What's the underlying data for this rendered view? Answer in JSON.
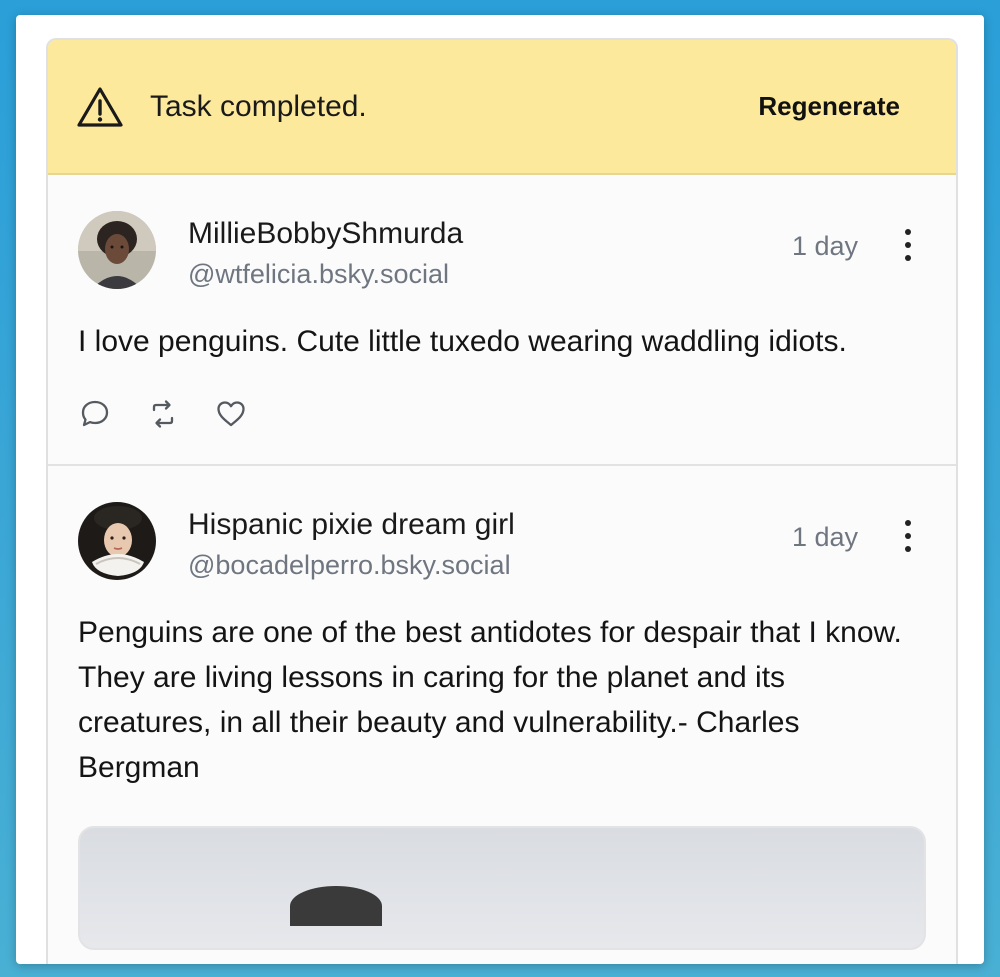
{
  "banner": {
    "icon": "warning-triangle-icon",
    "message": "Task completed.",
    "action_label": "Regenerate",
    "background": "#fde99c"
  },
  "posts": [
    {
      "display_name": "MillieBobbyShmurda",
      "handle": "@wtfelicia.bsky.social",
      "time": "1 day",
      "text": "I love penguins. Cute little tuxedo wearing waddling idiots.",
      "actions": [
        "reply-icon",
        "repost-icon",
        "like-icon"
      ]
    },
    {
      "display_name": "Hispanic pixie dream girl",
      "handle": "@bocadelperro.bsky.social",
      "time": "1 day",
      "text": "Penguins are one of the best antidotes for despair that I know. They are living lessons in caring for the planet and its creatures, in all their beauty and vulnerability.- Charles Bergman"
    }
  ]
}
